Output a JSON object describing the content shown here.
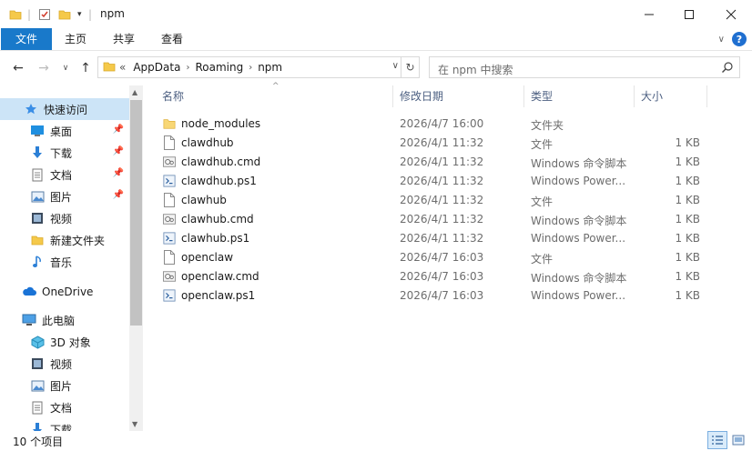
{
  "window": {
    "title": "npm",
    "minimize_icon": "minimize-icon",
    "maximize_icon": "maximize-icon",
    "close_icon": "close-icon"
  },
  "ribbon": {
    "tabs": [
      {
        "label": "文件"
      },
      {
        "label": "主页"
      },
      {
        "label": "共享"
      },
      {
        "label": "查看"
      }
    ],
    "accent": "#1979ca"
  },
  "address": {
    "prefix": "«",
    "crumbs": [
      "AppData",
      "Roaming",
      "npm"
    ]
  },
  "search": {
    "placeholder": "在 npm 中搜索"
  },
  "sidebar": {
    "items": [
      {
        "label": "快速访问",
        "icon": "star-icon",
        "pinned": false,
        "active": true
      },
      {
        "label": "桌面",
        "icon": "desktop-icon",
        "pinned": true
      },
      {
        "label": "下载",
        "icon": "download-icon",
        "pinned": true
      },
      {
        "label": "文档",
        "icon": "document-icon",
        "pinned": true
      },
      {
        "label": "图片",
        "icon": "picture-icon",
        "pinned": true
      },
      {
        "label": "视频",
        "icon": "video-icon",
        "pinned": false
      },
      {
        "label": "新建文件夹",
        "icon": "folder-icon",
        "pinned": false
      },
      {
        "label": "音乐",
        "icon": "music-icon",
        "pinned": false
      },
      {
        "label": "OneDrive",
        "icon": "cloud-icon",
        "pinned": false
      },
      {
        "label": "此电脑",
        "icon": "computer-icon",
        "pinned": false
      },
      {
        "label": "3D 对象",
        "icon": "cube-icon",
        "pinned": false
      },
      {
        "label": "视频",
        "icon": "video-icon",
        "pinned": false
      },
      {
        "label": "图片",
        "icon": "picture-icon",
        "pinned": false
      },
      {
        "label": "文档",
        "icon": "document-icon",
        "pinned": false
      },
      {
        "label": "下载",
        "icon": "download-icon",
        "pinned": false
      }
    ]
  },
  "columns": {
    "name": "名称",
    "date": "修改日期",
    "type": "类型",
    "size": "大小"
  },
  "files": [
    {
      "name": "node_modules",
      "date": "2026/4/7 16:00",
      "type": "文件夹",
      "size": "",
      "icon": "folder-icon"
    },
    {
      "name": "clawdhub",
      "date": "2026/4/1 11:32",
      "type": "文件",
      "size": "1 KB",
      "icon": "file-icon"
    },
    {
      "name": "clawdhub.cmd",
      "date": "2026/4/1 11:32",
      "type": "Windows 命令脚本",
      "size": "1 KB",
      "icon": "cmd-icon"
    },
    {
      "name": "clawdhub.ps1",
      "date": "2026/4/1 11:32",
      "type": "Windows Power...",
      "size": "1 KB",
      "icon": "ps1-icon"
    },
    {
      "name": "clawhub",
      "date": "2026/4/1 11:32",
      "type": "文件",
      "size": "1 KB",
      "icon": "file-icon"
    },
    {
      "name": "clawhub.cmd",
      "date": "2026/4/1 11:32",
      "type": "Windows 命令脚本",
      "size": "1 KB",
      "icon": "cmd-icon"
    },
    {
      "name": "clawhub.ps1",
      "date": "2026/4/1 11:32",
      "type": "Windows Power...",
      "size": "1 KB",
      "icon": "ps1-icon"
    },
    {
      "name": "openclaw",
      "date": "2026/4/7 16:03",
      "type": "文件",
      "size": "1 KB",
      "icon": "file-icon"
    },
    {
      "name": "openclaw.cmd",
      "date": "2026/4/7 16:03",
      "type": "Windows 命令脚本",
      "size": "1 KB",
      "icon": "cmd-icon"
    },
    {
      "name": "openclaw.ps1",
      "date": "2026/4/7 16:03",
      "type": "Windows Power...",
      "size": "1 KB",
      "icon": "ps1-icon"
    }
  ],
  "status": {
    "count": "10 个项目"
  }
}
